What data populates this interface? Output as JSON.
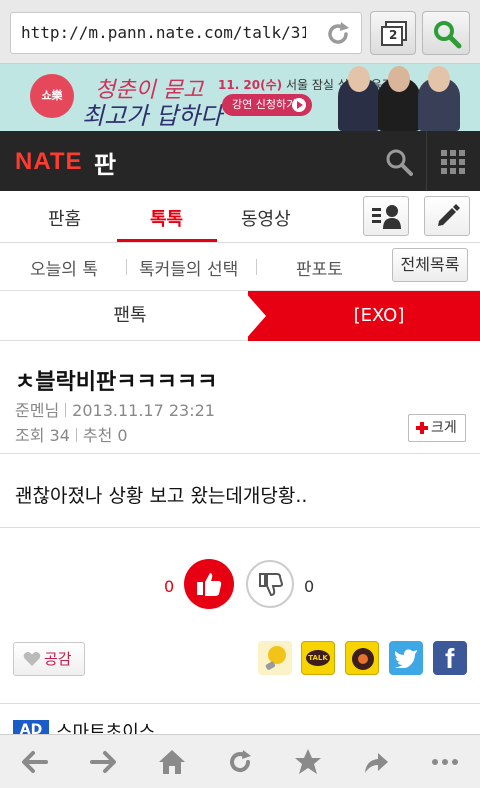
{
  "browser": {
    "url": "http://m.pann.nate.com/talk/3199…",
    "tab_count": "2"
  },
  "banner": {
    "logo_text": "쇼樂",
    "slogan_line1": "청춘이 묻고",
    "slogan_line2": "최고가 답하다",
    "date_prefix": "11. 20(수)",
    "date_suffix": "서울 잠실 실내체육관",
    "cta": "강연 신청하기"
  },
  "header": {
    "logo": "NATE",
    "section": "판"
  },
  "main_nav": {
    "items": [
      "판홈",
      "톡톡",
      "동영상"
    ],
    "active": "톡톡"
  },
  "sub_nav": {
    "items": [
      "오늘의 톡",
      "톡커들의 선택",
      "판포토"
    ],
    "all_list": "전체목록"
  },
  "category": {
    "left": "팬톡",
    "right": "[EXO]"
  },
  "post": {
    "title": "ㅊ블락비판ㅋㅋㅋㅋㅋ",
    "author": "준멘님",
    "datetime": "2013.11.17 23:21",
    "views_label": "조회 34",
    "recommend_label": "추천 0",
    "bigger_label": "크게",
    "body": "괜찮아졌나 상황 보고 왔는데개당황.."
  },
  "votes": {
    "up": "0",
    "down": "0"
  },
  "share": {
    "like_label": "공감",
    "icons": [
      "mystory-icon",
      "kakaotalk-icon",
      "kakaostory-icon",
      "twitter-icon",
      "facebook-icon"
    ]
  },
  "ad": {
    "badge": "AD",
    "text": "스마트초이스"
  },
  "colors": {
    "accent": "#e60012",
    "header_bg": "#262626",
    "banner_bg": "#bfe6e2"
  }
}
